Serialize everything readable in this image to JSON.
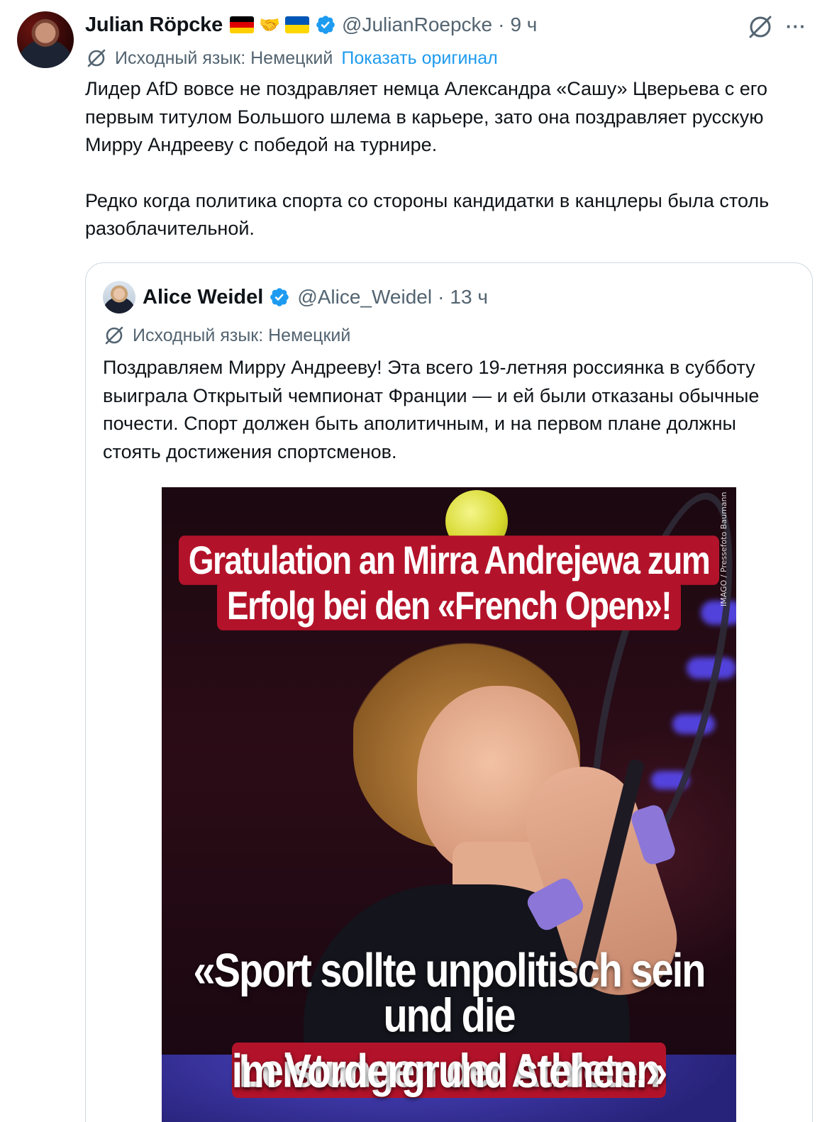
{
  "tweet": {
    "author_name": "Julian Röpcke",
    "handle": "@JulianRoepcke",
    "separator": "·",
    "time": "9 ч",
    "more": "···",
    "translate_label": "Исходный язык: Немецкий",
    "show_original": "Показать оригинал",
    "text_paragraphs": [
      "Лидер AfD вовсе не поздравляет немца Александра «Сашу» Цверьева с его первым титулом Большого шлема в карьере, зато она поздравляет русскую Мирру Андрееву с победой на турнире.",
      "Редко когда политика спорта со стороны кандидатки в канцлеры была столь разоблачительной."
    ],
    "flags": [
      "flag-germany",
      "handshake-emoji",
      "flag-ukraine"
    ]
  },
  "quote": {
    "author_name": "Alice Weidel",
    "handle": "@Alice_Weidel",
    "separator": "·",
    "time": "13 ч",
    "translate_label": "Исходный язык: Немецкий",
    "text": "Поздравляем Мирру Андрееву! Эта всего 19-летняя россиянка в субботу выиграла Открытый чемпионат Франции — и ей были отказаны обычные почести. Спорт должен быть аполитичным, и на первом плане должны стоять достижения спортсменов.",
    "image": {
      "headline_line1": "Gratulation an Mirra Andrejewa zum",
      "headline_line2": "Erfolg bei den «French Open»!",
      "quote_line1": "«Sport sollte unpolitisch sein",
      "quote_line2_plain": "und die ",
      "quote_line2_highlight": "Leistungen der Athleten",
      "quote_line3": "im Vordergrund stehen.»",
      "credit": "IMAGO / Pressefoto Baumann"
    }
  },
  "colors": {
    "text": "#0f1419",
    "secondary": "#536471",
    "link": "#1d9bf0",
    "verified": "#1d9bf0",
    "border": "#cfd9de",
    "headline_red": "#b3132a"
  }
}
